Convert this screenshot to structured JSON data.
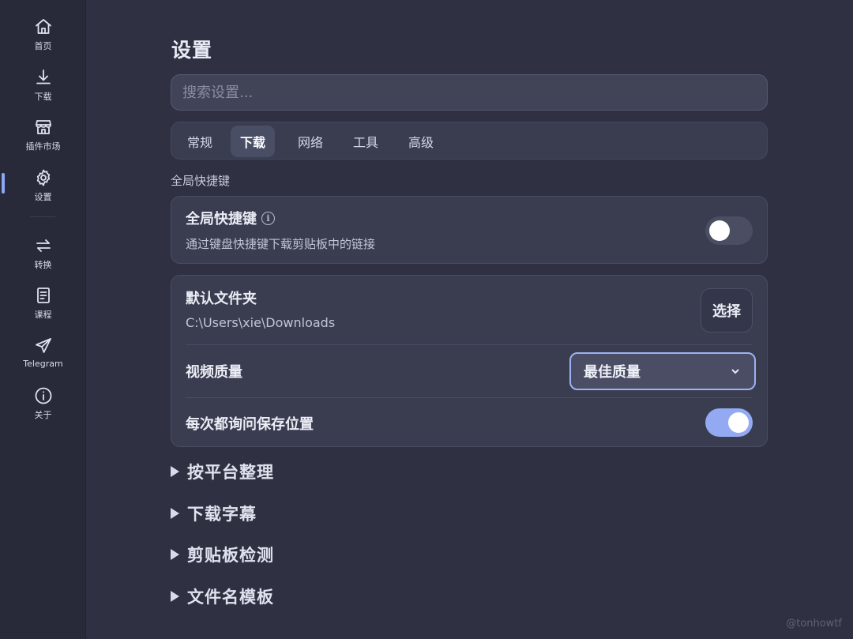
{
  "sidebar": {
    "items": [
      {
        "label": "首页",
        "icon": "home-icon"
      },
      {
        "label": "下载",
        "icon": "download-icon"
      },
      {
        "label": "插件市场",
        "icon": "store-icon"
      },
      {
        "label": "设置",
        "icon": "gear-icon",
        "active": true
      },
      {
        "label": "转换",
        "icon": "arrows-swap-icon"
      },
      {
        "label": "课程",
        "icon": "book-icon"
      },
      {
        "label": "Telegram",
        "icon": "send-icon"
      },
      {
        "label": "关于",
        "icon": "info-icon"
      }
    ]
  },
  "main": {
    "title": "设置",
    "search": {
      "placeholder": "搜索设置...",
      "value": ""
    },
    "tabs": [
      {
        "label": "常规"
      },
      {
        "label": "下载",
        "active": true
      },
      {
        "label": "网络"
      },
      {
        "label": "工具"
      },
      {
        "label": "高级"
      }
    ],
    "section_heading": "全局快捷键",
    "hotkey_card": {
      "title": "全局快捷键",
      "description": "通过键盘快捷键下载剪贴板中的链接",
      "enabled": false
    },
    "download_card": {
      "folder_title": "默认文件夹",
      "folder_path": "C:\\Users\\xie\\Downloads",
      "choose_label": "选择",
      "quality_title": "视频质量",
      "quality_value": "最佳质量",
      "ask_title": "每次都询问保存位置",
      "ask_enabled": true
    },
    "collapsibles": [
      {
        "label": "按平台整理"
      },
      {
        "label": "下载字幕"
      },
      {
        "label": "剪贴板检测"
      },
      {
        "label": "文件名模板"
      }
    ]
  },
  "watermark": "@tonhowtf",
  "colors": {
    "background": "#2f3143",
    "sidebar": "#282a3a",
    "card": "#3a3d50",
    "accent": "#93aaf2"
  }
}
